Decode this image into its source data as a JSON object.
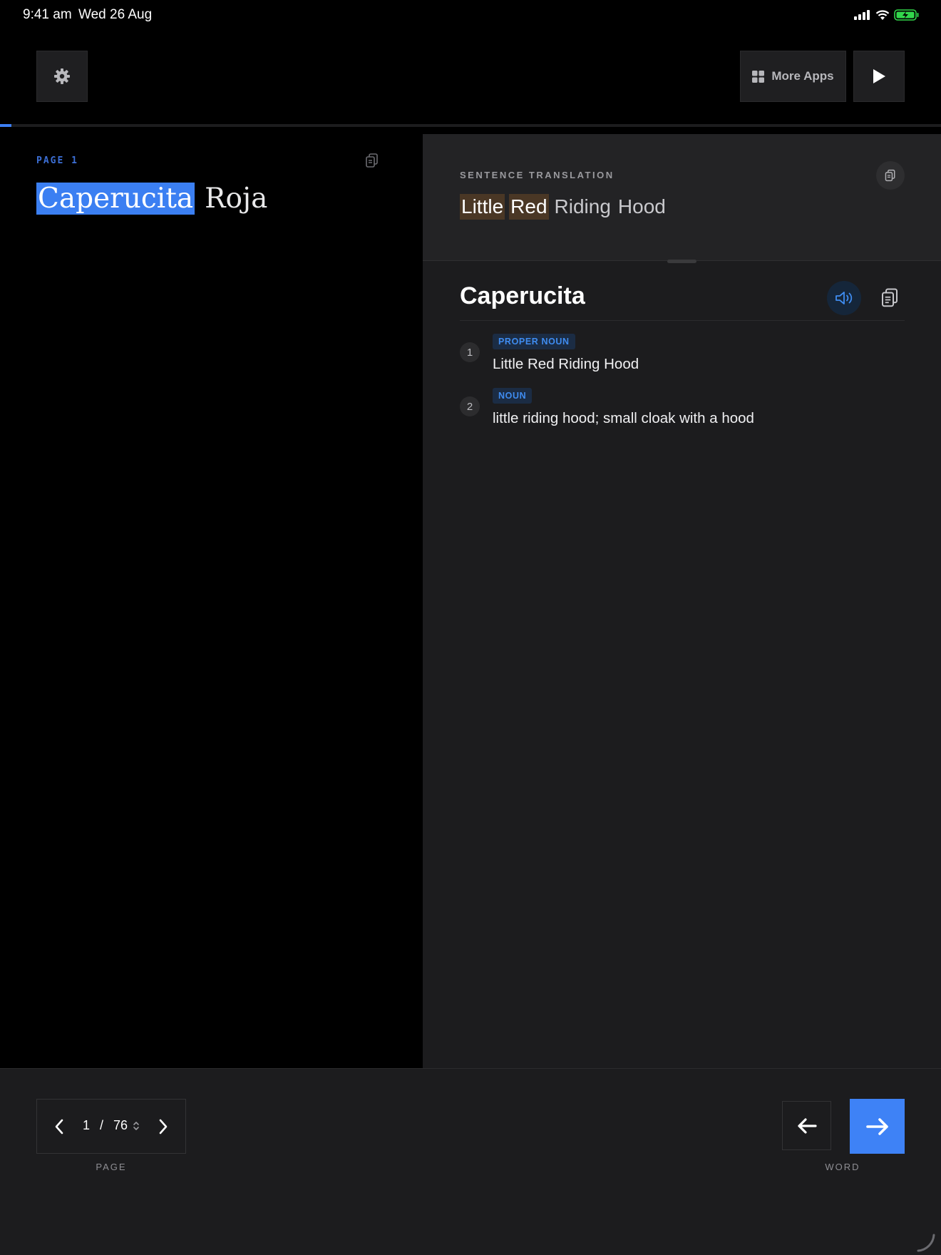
{
  "status_bar": {
    "time": "9:41 am",
    "date": "Wed 26 Aug",
    "icons": [
      "cellular-signal-icon",
      "wifi-icon",
      "battery-charging-icon"
    ]
  },
  "toolbar": {
    "settings_icon": "gear-icon",
    "more_apps_label": "More Apps",
    "more_apps_icon": "grid-icon",
    "play_icon": "play-icon"
  },
  "reading_progress": 0.012,
  "reader": {
    "page_label": "PAGE 1",
    "sentence_words": [
      "Caperucita",
      "Roja"
    ],
    "selected_word": "Caperucita"
  },
  "translation": {
    "label": "SENTENCE TRANSLATION",
    "words": [
      "Little",
      "Red",
      "Riding",
      "Hood"
    ],
    "highlighted": [
      "Little",
      "Red"
    ]
  },
  "dictionary": {
    "word": "Caperucita",
    "definitions": [
      {
        "number": "1",
        "part_of_speech": "PROPER NOUN",
        "meaning": "Little Red Riding Hood"
      },
      {
        "number": "2",
        "part_of_speech": "NOUN",
        "meaning": "little riding hood; small cloak with a hood"
      }
    ]
  },
  "pager": {
    "current": "1",
    "separator": "/",
    "total": "76",
    "caption": "PAGE"
  },
  "word_nav": {
    "caption": "WORD"
  },
  "colors": {
    "accent": "#3e82f6",
    "translation_highlight": "#4a3725",
    "panel_bg": "#1c1c1e",
    "tag_bg": "#1b2c44"
  }
}
